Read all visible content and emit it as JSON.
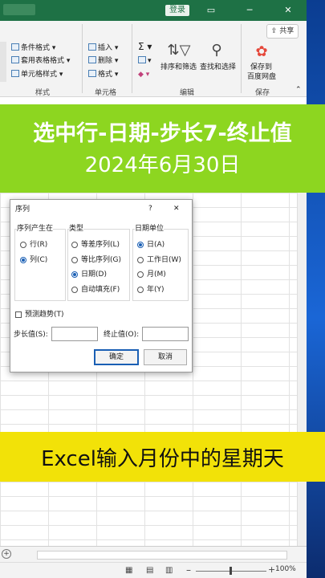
{
  "titlebar": {
    "login": "登录",
    "minimize": "▭",
    "restore": "─",
    "close": "✕"
  },
  "ribbon": {
    "share": "共享",
    "styles": {
      "conditional_format": "条件格式",
      "table_format": "套用表格格式",
      "cell_style": "单元格样式",
      "group_label": "样式"
    },
    "cells": {
      "insert": "插入",
      "delete": "删除",
      "format": "格式",
      "group_label": "单元格"
    },
    "editing": {
      "sum_symbol": "Σ",
      "sort_filter": "排序和筛选",
      "find_select": "查找和选择",
      "group_label": "编辑"
    },
    "save": {
      "line1": "保存到",
      "line2": "百度网盘",
      "group_label": "保存"
    }
  },
  "banner_top": {
    "line1": "选中行-日期-步长7-终止值",
    "line2": "2024年6月30日"
  },
  "banner_bottom": {
    "text": "Excel输入月份中的星期天"
  },
  "dialog": {
    "title": "序列",
    "help": "?",
    "close": "✕",
    "series_in": {
      "label": "序列产生在",
      "row": "行(R)",
      "col": "列(C)"
    },
    "type": {
      "label": "类型",
      "linear": "等差序列(L)",
      "growth": "等比序列(G)",
      "date": "日期(D)",
      "autofill": "自动填充(F)"
    },
    "date_unit": {
      "label": "日期单位",
      "day": "日(A)",
      "weekday": "工作日(W)",
      "month": "月(M)",
      "year": "年(Y)"
    },
    "trend": "预测趋势(T)",
    "step_label": "步长值(S):",
    "stop_label": "终止值(O):",
    "step_value": "",
    "stop_value": "",
    "ok": "确定",
    "cancel": "取消"
  },
  "status": {
    "zoom": "100%"
  }
}
